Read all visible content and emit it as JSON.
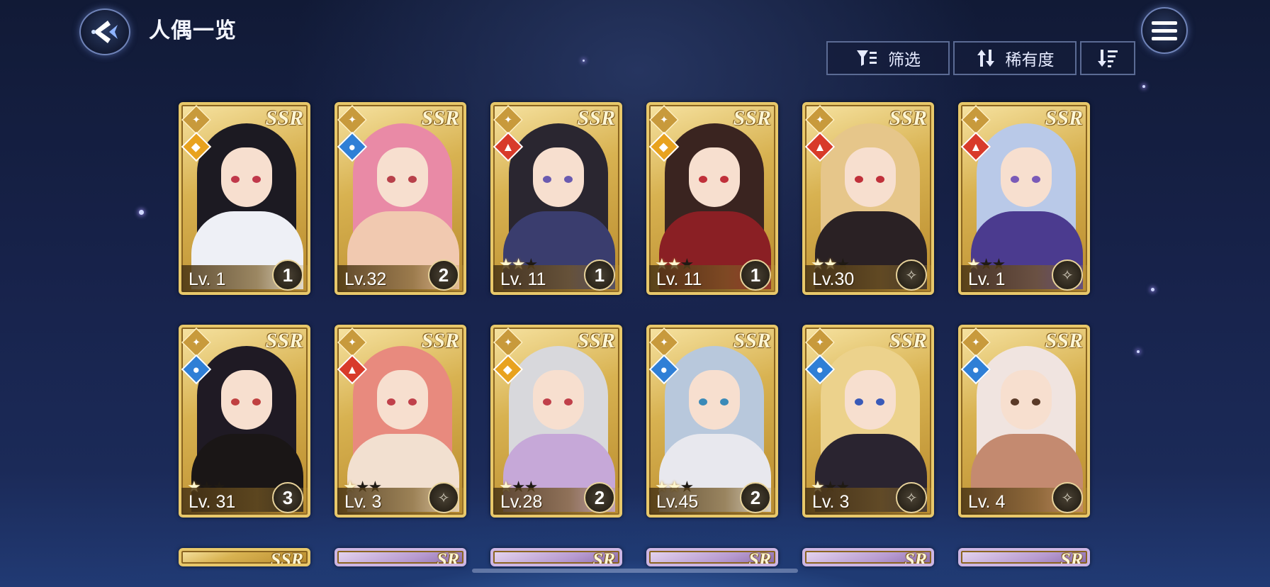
{
  "header": {
    "title": "人偶一览",
    "filter_label": "筛选",
    "rarity_label": "稀有度"
  },
  "colors": {
    "card_gold": "#e8c86a",
    "water": "#2f7fd6",
    "fire": "#d83a2a",
    "light": "#e8a21e"
  },
  "cards": [
    {
      "rarity": "SSR",
      "element": "light",
      "level": "Lv. 1",
      "stars": 0,
      "rank": "1",
      "hair": "#1c1a22",
      "outfit": "#eef0f6",
      "eye": "#c0384a"
    },
    {
      "rarity": "SSR",
      "element": "water",
      "level": "Lv.32",
      "stars": 0,
      "rank": "2",
      "hair": "#e98aa6",
      "outfit": "#f1c9b0",
      "eye": "#b8404a"
    },
    {
      "rarity": "SSR",
      "element": "fire",
      "level": "Lv. 11",
      "stars": 2,
      "rank": "1",
      "hair": "#2a2630",
      "outfit": "#3a3d6e",
      "eye": "#6a5ab0"
    },
    {
      "rarity": "SSR",
      "element": "light",
      "level": "Lv. 11",
      "stars": 2,
      "rank": "1",
      "hair": "#3a2420",
      "outfit": "#8a1f24",
      "eye": "#c0303a"
    },
    {
      "rarity": "SSR",
      "element": "fire",
      "level": "Lv.30",
      "stars": 2,
      "rank": "",
      "hair": "#e6c68a",
      "outfit": "#2a2124",
      "eye": "#c0303a"
    },
    {
      "rarity": "SSR",
      "element": "fire",
      "level": "Lv. 1",
      "stars": 1,
      "rank": "",
      "hair": "#b9c9e8",
      "outfit": "#4b3b8f",
      "eye": "#7a5ab8"
    },
    {
      "rarity": "SSR",
      "element": "water",
      "level": "Lv. 31",
      "stars": 1,
      "rank": "3",
      "hair": "#1f1a24",
      "outfit": "#1a1616",
      "eye": "#c04040"
    },
    {
      "rarity": "SSR",
      "element": "fire",
      "level": "Lv. 3",
      "stars": 1,
      "rank": "",
      "hair": "#e88a7e",
      "outfit": "#f2e0d0",
      "eye": "#c0404a"
    },
    {
      "rarity": "SSR",
      "element": "light",
      "level": "Lv.28",
      "stars": 1,
      "rank": "2",
      "hair": "#d8d8dc",
      "outfit": "#c6a8d8",
      "eye": "#c0404a"
    },
    {
      "rarity": "SSR",
      "element": "water",
      "level": "Lv.45",
      "stars": 2,
      "rank": "2",
      "hair": "#b8c8dc",
      "outfit": "#e8e8ee",
      "eye": "#3a8ab8"
    },
    {
      "rarity": "SSR",
      "element": "water",
      "level": "Lv. 3",
      "stars": 1,
      "rank": "",
      "hair": "#ecd28c",
      "outfit": "#2a2430",
      "eye": "#3a5ab8"
    },
    {
      "rarity": "SSR",
      "element": "water",
      "level": "Lv. 4",
      "stars": 0,
      "rank": "",
      "hair": "#f0e4e0",
      "outfit": "#c48a70",
      "eye": "#5a3a28"
    }
  ],
  "peek_cards": [
    {
      "rarity": "SSR"
    },
    {
      "rarity": "SR"
    },
    {
      "rarity": "SR"
    },
    {
      "rarity": "SR"
    },
    {
      "rarity": "SR"
    },
    {
      "rarity": "SR"
    }
  ]
}
